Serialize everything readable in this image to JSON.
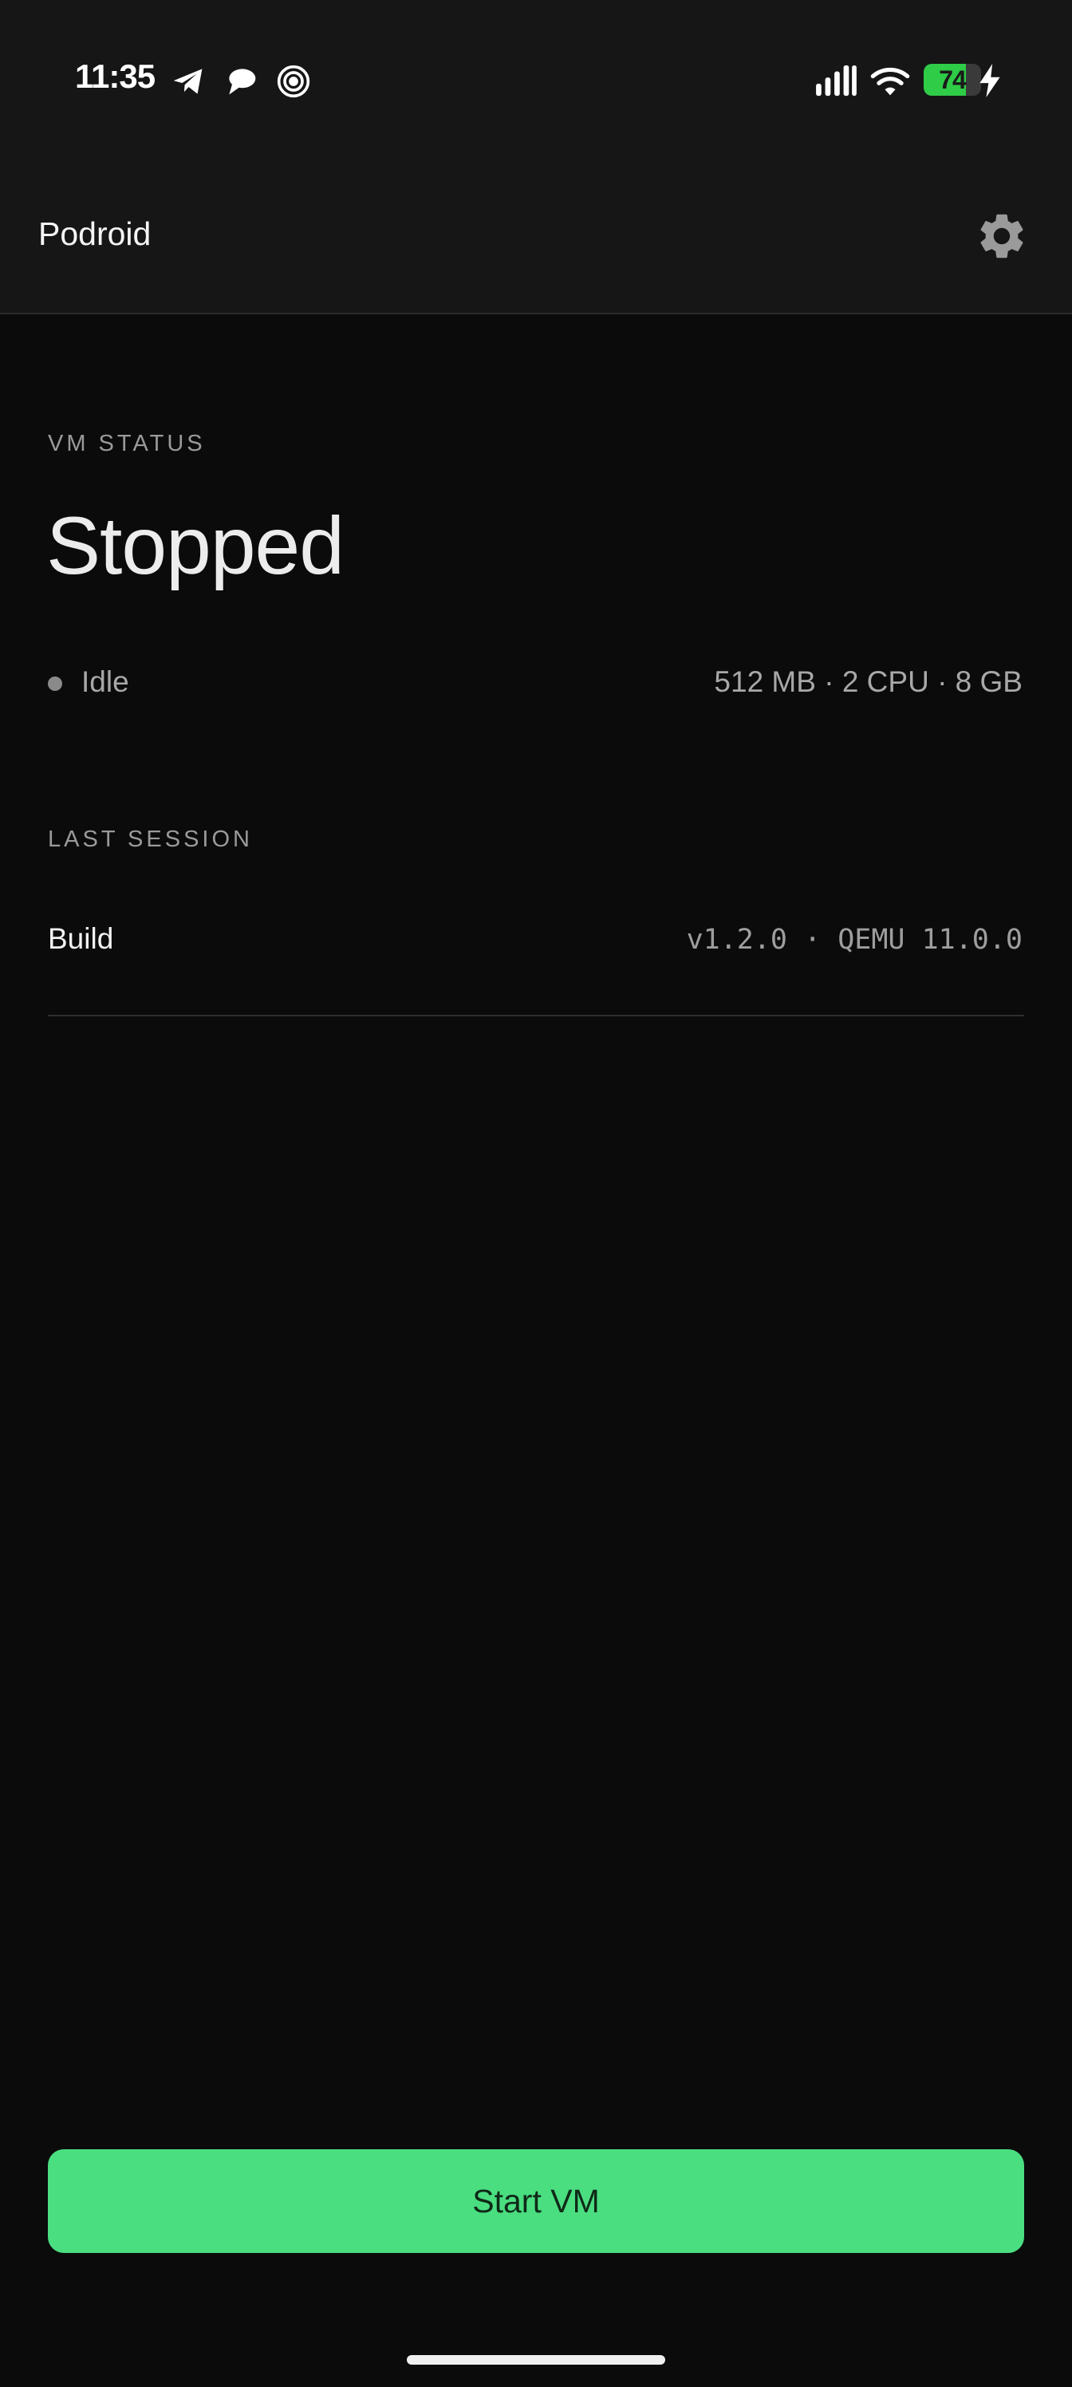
{
  "status_bar": {
    "time": "11:35",
    "left_icons": [
      "telegram-icon",
      "chat-bubbles-icon",
      "spiral-app-icon"
    ],
    "right_icons": [
      "cellular-signal-icon",
      "wifi-icon",
      "battery-icon",
      "charging-bolt-icon"
    ],
    "battery_level": "74",
    "battery_fraction": 0.74,
    "battery_color": "#2ecc47"
  },
  "app_bar": {
    "title": "Podroid",
    "settings_icon": "gear-icon"
  },
  "vm_status": {
    "section_label": "VM STATUS",
    "state": "Stopped",
    "activity": "Idle",
    "resources": "512 MB · 2 CPU · 8 GB"
  },
  "last_session": {
    "section_label": "LAST SESSION",
    "build_label": "Build",
    "build_value": "v1.2.0 · QEMU 11.0.0"
  },
  "actions": {
    "start_label": "Start VM",
    "accent_color": "#4ade80"
  }
}
